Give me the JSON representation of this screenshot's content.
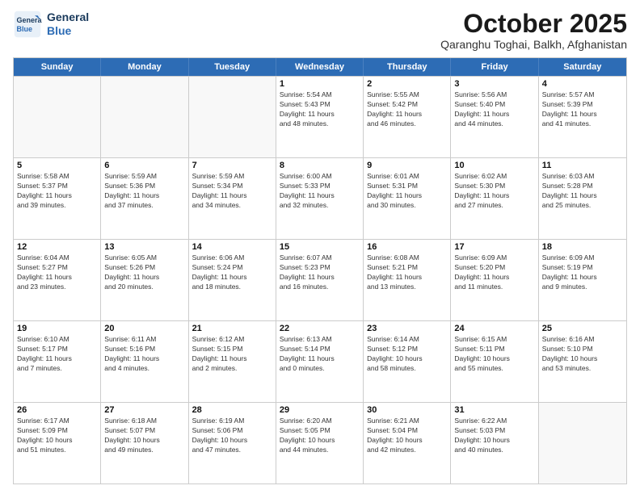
{
  "logo": {
    "line1": "General",
    "line2": "Blue"
  },
  "title": "October 2025",
  "subtitle": "Qaranghu Toghai, Balkh, Afghanistan",
  "days_of_week": [
    "Sunday",
    "Monday",
    "Tuesday",
    "Wednesday",
    "Thursday",
    "Friday",
    "Saturday"
  ],
  "weeks": [
    [
      {
        "day": "",
        "detail": ""
      },
      {
        "day": "",
        "detail": ""
      },
      {
        "day": "",
        "detail": ""
      },
      {
        "day": "1",
        "detail": "Sunrise: 5:54 AM\nSunset: 5:43 PM\nDaylight: 11 hours\nand 48 minutes."
      },
      {
        "day": "2",
        "detail": "Sunrise: 5:55 AM\nSunset: 5:42 PM\nDaylight: 11 hours\nand 46 minutes."
      },
      {
        "day": "3",
        "detail": "Sunrise: 5:56 AM\nSunset: 5:40 PM\nDaylight: 11 hours\nand 44 minutes."
      },
      {
        "day": "4",
        "detail": "Sunrise: 5:57 AM\nSunset: 5:39 PM\nDaylight: 11 hours\nand 41 minutes."
      }
    ],
    [
      {
        "day": "5",
        "detail": "Sunrise: 5:58 AM\nSunset: 5:37 PM\nDaylight: 11 hours\nand 39 minutes."
      },
      {
        "day": "6",
        "detail": "Sunrise: 5:59 AM\nSunset: 5:36 PM\nDaylight: 11 hours\nand 37 minutes."
      },
      {
        "day": "7",
        "detail": "Sunrise: 5:59 AM\nSunset: 5:34 PM\nDaylight: 11 hours\nand 34 minutes."
      },
      {
        "day": "8",
        "detail": "Sunrise: 6:00 AM\nSunset: 5:33 PM\nDaylight: 11 hours\nand 32 minutes."
      },
      {
        "day": "9",
        "detail": "Sunrise: 6:01 AM\nSunset: 5:31 PM\nDaylight: 11 hours\nand 30 minutes."
      },
      {
        "day": "10",
        "detail": "Sunrise: 6:02 AM\nSunset: 5:30 PM\nDaylight: 11 hours\nand 27 minutes."
      },
      {
        "day": "11",
        "detail": "Sunrise: 6:03 AM\nSunset: 5:28 PM\nDaylight: 11 hours\nand 25 minutes."
      }
    ],
    [
      {
        "day": "12",
        "detail": "Sunrise: 6:04 AM\nSunset: 5:27 PM\nDaylight: 11 hours\nand 23 minutes."
      },
      {
        "day": "13",
        "detail": "Sunrise: 6:05 AM\nSunset: 5:26 PM\nDaylight: 11 hours\nand 20 minutes."
      },
      {
        "day": "14",
        "detail": "Sunrise: 6:06 AM\nSunset: 5:24 PM\nDaylight: 11 hours\nand 18 minutes."
      },
      {
        "day": "15",
        "detail": "Sunrise: 6:07 AM\nSunset: 5:23 PM\nDaylight: 11 hours\nand 16 minutes."
      },
      {
        "day": "16",
        "detail": "Sunrise: 6:08 AM\nSunset: 5:21 PM\nDaylight: 11 hours\nand 13 minutes."
      },
      {
        "day": "17",
        "detail": "Sunrise: 6:09 AM\nSunset: 5:20 PM\nDaylight: 11 hours\nand 11 minutes."
      },
      {
        "day": "18",
        "detail": "Sunrise: 6:09 AM\nSunset: 5:19 PM\nDaylight: 11 hours\nand 9 minutes."
      }
    ],
    [
      {
        "day": "19",
        "detail": "Sunrise: 6:10 AM\nSunset: 5:17 PM\nDaylight: 11 hours\nand 7 minutes."
      },
      {
        "day": "20",
        "detail": "Sunrise: 6:11 AM\nSunset: 5:16 PM\nDaylight: 11 hours\nand 4 minutes."
      },
      {
        "day": "21",
        "detail": "Sunrise: 6:12 AM\nSunset: 5:15 PM\nDaylight: 11 hours\nand 2 minutes."
      },
      {
        "day": "22",
        "detail": "Sunrise: 6:13 AM\nSunset: 5:14 PM\nDaylight: 11 hours\nand 0 minutes."
      },
      {
        "day": "23",
        "detail": "Sunrise: 6:14 AM\nSunset: 5:12 PM\nDaylight: 10 hours\nand 58 minutes."
      },
      {
        "day": "24",
        "detail": "Sunrise: 6:15 AM\nSunset: 5:11 PM\nDaylight: 10 hours\nand 55 minutes."
      },
      {
        "day": "25",
        "detail": "Sunrise: 6:16 AM\nSunset: 5:10 PM\nDaylight: 10 hours\nand 53 minutes."
      }
    ],
    [
      {
        "day": "26",
        "detail": "Sunrise: 6:17 AM\nSunset: 5:09 PM\nDaylight: 10 hours\nand 51 minutes."
      },
      {
        "day": "27",
        "detail": "Sunrise: 6:18 AM\nSunset: 5:07 PM\nDaylight: 10 hours\nand 49 minutes."
      },
      {
        "day": "28",
        "detail": "Sunrise: 6:19 AM\nSunset: 5:06 PM\nDaylight: 10 hours\nand 47 minutes."
      },
      {
        "day": "29",
        "detail": "Sunrise: 6:20 AM\nSunset: 5:05 PM\nDaylight: 10 hours\nand 44 minutes."
      },
      {
        "day": "30",
        "detail": "Sunrise: 6:21 AM\nSunset: 5:04 PM\nDaylight: 10 hours\nand 42 minutes."
      },
      {
        "day": "31",
        "detail": "Sunrise: 6:22 AM\nSunset: 5:03 PM\nDaylight: 10 hours\nand 40 minutes."
      },
      {
        "day": "",
        "detail": ""
      }
    ]
  ]
}
